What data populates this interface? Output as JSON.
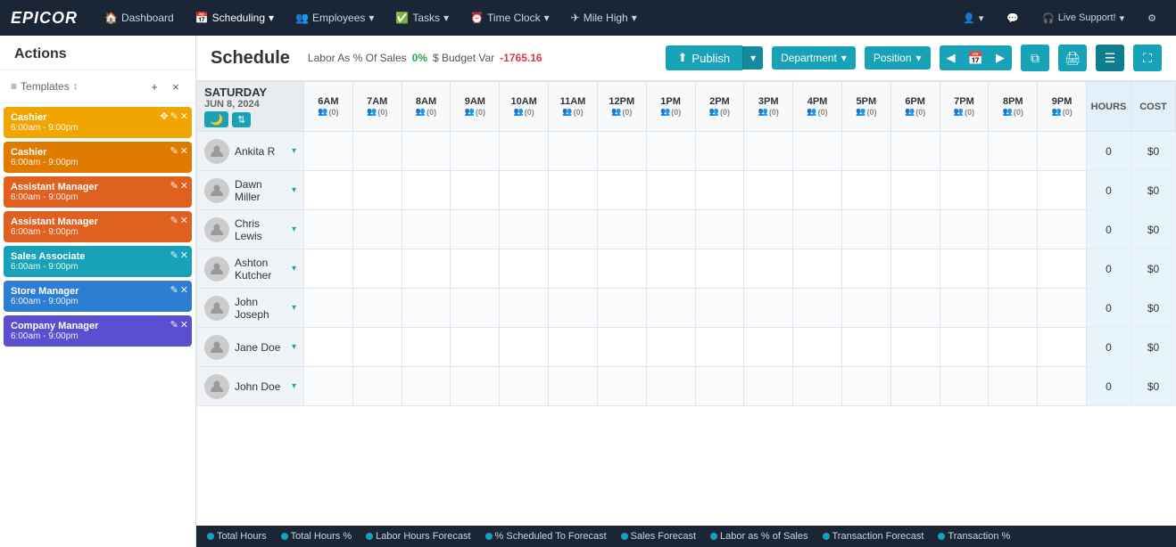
{
  "brand": "EPICOR",
  "nav": {
    "items": [
      {
        "label": "Dashboard",
        "icon": "🏠",
        "active": false
      },
      {
        "label": "Scheduling",
        "icon": "📅",
        "active": true,
        "has_caret": true
      },
      {
        "label": "Employees",
        "icon": "👥",
        "active": false,
        "has_caret": true
      },
      {
        "label": "Tasks",
        "icon": "✅",
        "active": false,
        "has_caret": true
      },
      {
        "label": "Time Clock",
        "icon": "⏰",
        "active": false,
        "has_caret": true
      },
      {
        "label": "Mile High",
        "icon": "✈",
        "active": false,
        "has_caret": true
      }
    ],
    "right_items": [
      {
        "label": "",
        "icon": "👤",
        "has_caret": true
      },
      {
        "label": "",
        "icon": "💬"
      },
      {
        "label": "Live Support!",
        "icon": "🎧",
        "has_caret": true
      },
      {
        "label": "",
        "icon": "⚙"
      }
    ]
  },
  "sidebar": {
    "actions_label": "Actions",
    "templates_label": "Templates",
    "templates_icon": "≡",
    "sort_icon": "↕",
    "add_icon": "+",
    "close_icon": "×",
    "cards": [
      {
        "title": "Cashier",
        "time": "6:00am - 9:00pm",
        "color": "#f0a500",
        "has_drag": true,
        "has_edit": true,
        "has_delete": true
      },
      {
        "title": "Cashier",
        "time": "6:00am - 9:00pm",
        "color": "#e07b00",
        "has_drag": false,
        "has_edit": true,
        "has_delete": true
      },
      {
        "title": "Assistant Manager",
        "time": "6:00am - 9:00pm",
        "color": "#e06020",
        "has_drag": false,
        "has_edit": true,
        "has_delete": true
      },
      {
        "title": "Assistant Manager",
        "time": "6:00am - 9:00pm",
        "color": "#e06020",
        "has_drag": false,
        "has_edit": true,
        "has_delete": true
      },
      {
        "title": "Sales Associate",
        "time": "6:00am - 9:00pm",
        "color": "#17a2b8",
        "has_drag": false,
        "has_edit": true,
        "has_delete": true
      },
      {
        "title": "Store Manager",
        "time": "6:00am - 9:00pm",
        "color": "#2d7dd2",
        "has_drag": false,
        "has_edit": true,
        "has_delete": true
      },
      {
        "title": "Company Manager",
        "time": "6:00am - 9:00pm",
        "color": "#5a4fcf",
        "has_drag": false,
        "has_edit": true,
        "has_delete": true
      }
    ]
  },
  "schedule": {
    "title": "Schedule",
    "labor_label": "Labor As % Of Sales",
    "labor_pct": "0%",
    "budget_label": "$ Budget Var",
    "budget_value": "-1765.16",
    "publish_label": "Publish",
    "department_label": "Department",
    "position_label": "Position",
    "date": {
      "day": "SATURDAY",
      "date": "JUN 8, 2024"
    },
    "time_cols": [
      {
        "label": "6AM",
        "count": "(0)"
      },
      {
        "label": "7AM",
        "count": "(0)"
      },
      {
        "label": "8AM",
        "count": "(0)"
      },
      {
        "label": "9AM",
        "count": "(0)"
      },
      {
        "label": "10AM",
        "count": "(0)"
      },
      {
        "label": "11AM",
        "count": "(0)"
      },
      {
        "label": "12PM",
        "count": "(0)"
      },
      {
        "label": "1PM",
        "count": "(0)"
      },
      {
        "label": "2PM",
        "count": "(0)"
      },
      {
        "label": "3PM",
        "count": "(0)"
      },
      {
        "label": "4PM",
        "count": "(0)"
      },
      {
        "label": "5PM",
        "count": "(0)"
      },
      {
        "label": "6PM",
        "count": "(0)"
      },
      {
        "label": "7PM",
        "count": "(0)"
      },
      {
        "label": "8PM",
        "count": "(0)"
      },
      {
        "label": "9PM",
        "count": "(0)"
      }
    ],
    "hours_label": "HOURS",
    "cost_label": "COST",
    "employees": [
      {
        "name": "Ankita R",
        "hours": 0,
        "cost": "$0"
      },
      {
        "name": "Dawn Miller",
        "hours": 0,
        "cost": "$0"
      },
      {
        "name": "Chris Lewis",
        "hours": 0,
        "cost": "$0"
      },
      {
        "name": "Ashton Kutcher",
        "hours": 0,
        "cost": "$0"
      },
      {
        "name": "John Joseph",
        "hours": 0,
        "cost": "$0"
      },
      {
        "name": "Jane Doe",
        "hours": 0,
        "cost": "$0"
      },
      {
        "name": "John Doe",
        "hours": 0,
        "cost": "$0"
      }
    ]
  },
  "footer": {
    "items": [
      {
        "label": "Total Hours"
      },
      {
        "label": "Total Hours %"
      },
      {
        "label": "Labor Hours Forecast"
      },
      {
        "label": "% Scheduled To Forecast"
      },
      {
        "label": "Sales Forecast"
      },
      {
        "label": "Labor as % of Sales"
      },
      {
        "label": "Transaction Forecast"
      },
      {
        "label": "Transaction %"
      }
    ]
  }
}
